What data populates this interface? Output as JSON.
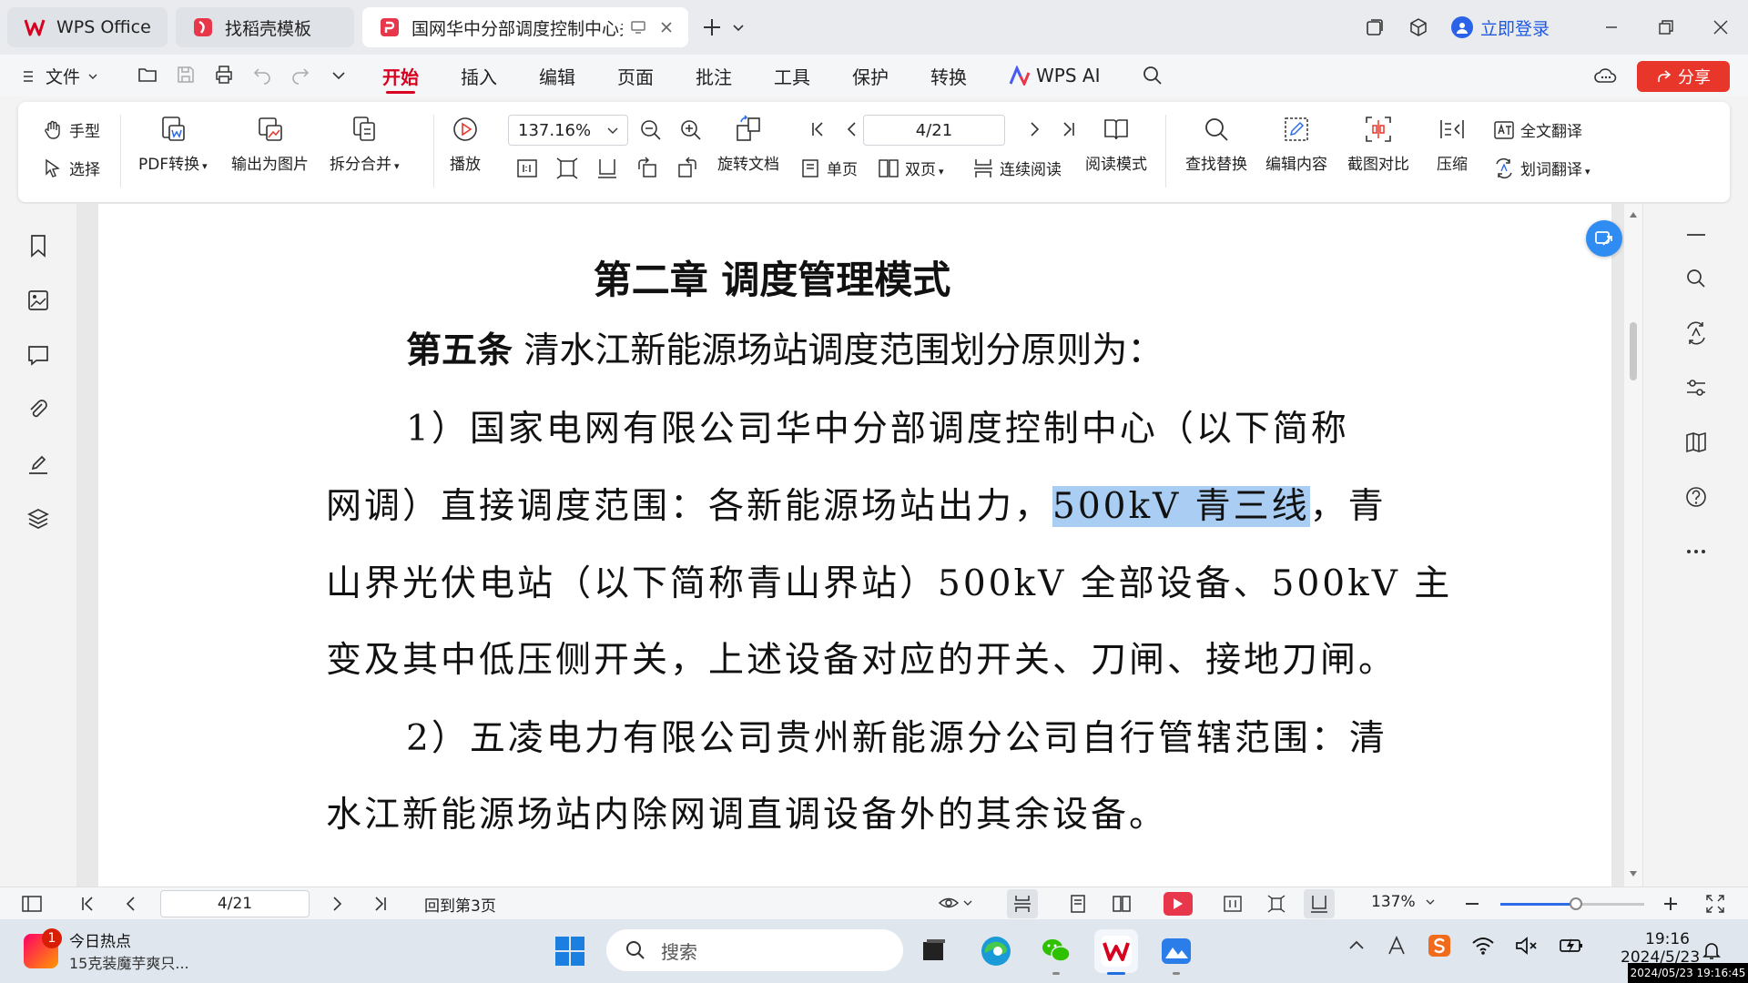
{
  "tabs": {
    "wps": "WPS Office",
    "docer": "找稻壳模板",
    "doc": "国网华中分部调度控制中心关",
    "login": "立即登录"
  },
  "menubar": {
    "file": "文件",
    "menus": [
      "开始",
      "插入",
      "编辑",
      "页面",
      "批注",
      "工具",
      "保护",
      "转换"
    ],
    "wps_ai": "WPS AI",
    "share": "分享"
  },
  "ribbon": {
    "hand": "手型",
    "select": "选择",
    "pdf_convert": "PDF转换",
    "export_image": "输出为图片",
    "split_merge": "拆分合并",
    "play": "播放",
    "zoom": "137.16%",
    "page": "4/21",
    "rotate_doc": "旋转文档",
    "single_page": "单页",
    "double_page": "双页",
    "continuous": "连续阅读",
    "read_mode": "阅读模式",
    "find_replace": "查找替换",
    "edit_content": "编辑内容",
    "screenshot_compare": "截图对比",
    "compress": "压缩",
    "full_translate": "全文翻译",
    "word_translate": "划词翻译"
  },
  "document": {
    "chapter": "第二章  调度管理模式",
    "article_label": "第五条",
    "article_text": " 清水江新能源场站调度范围划分原则为：",
    "p1_l1": "1）国家电网有限公司华中分部调度控制中心（以下简称",
    "p1_l2_a": "网调）直接调度范围：各新能源场站出力，",
    "p1_l2_hl": "500kV 青三线",
    "p1_l2_b": "，青",
    "p1_l3": "山界光伏电站（以下简称青山界站）500kV 全部设备、500kV 主",
    "p1_l4": "变及其中低压侧开关，上述设备对应的开关、刀闸、接地刀闸。",
    "p2_l1": "2）五凌电力有限公司贵州新能源分公司自行管辖范围：清",
    "p2_l2": "水江新能源场站内除网调直调设备外的其余设备。"
  },
  "statusbar": {
    "page": "4/21",
    "back_to": "回到第3页",
    "zoom": "137%"
  },
  "taskbar": {
    "news_title": "今日热点",
    "news_sub": "15克装魔芋爽只...",
    "news_badge": "1",
    "search": "搜索",
    "time": "19:16",
    "date": "2024/5/23",
    "stamp": "2024/05/23 19:16:45"
  },
  "colors": {
    "accent_red": "#d7001f",
    "share_red": "#e8362b",
    "link_blue": "#1f58e0",
    "highlight": "#a9cdf3"
  }
}
